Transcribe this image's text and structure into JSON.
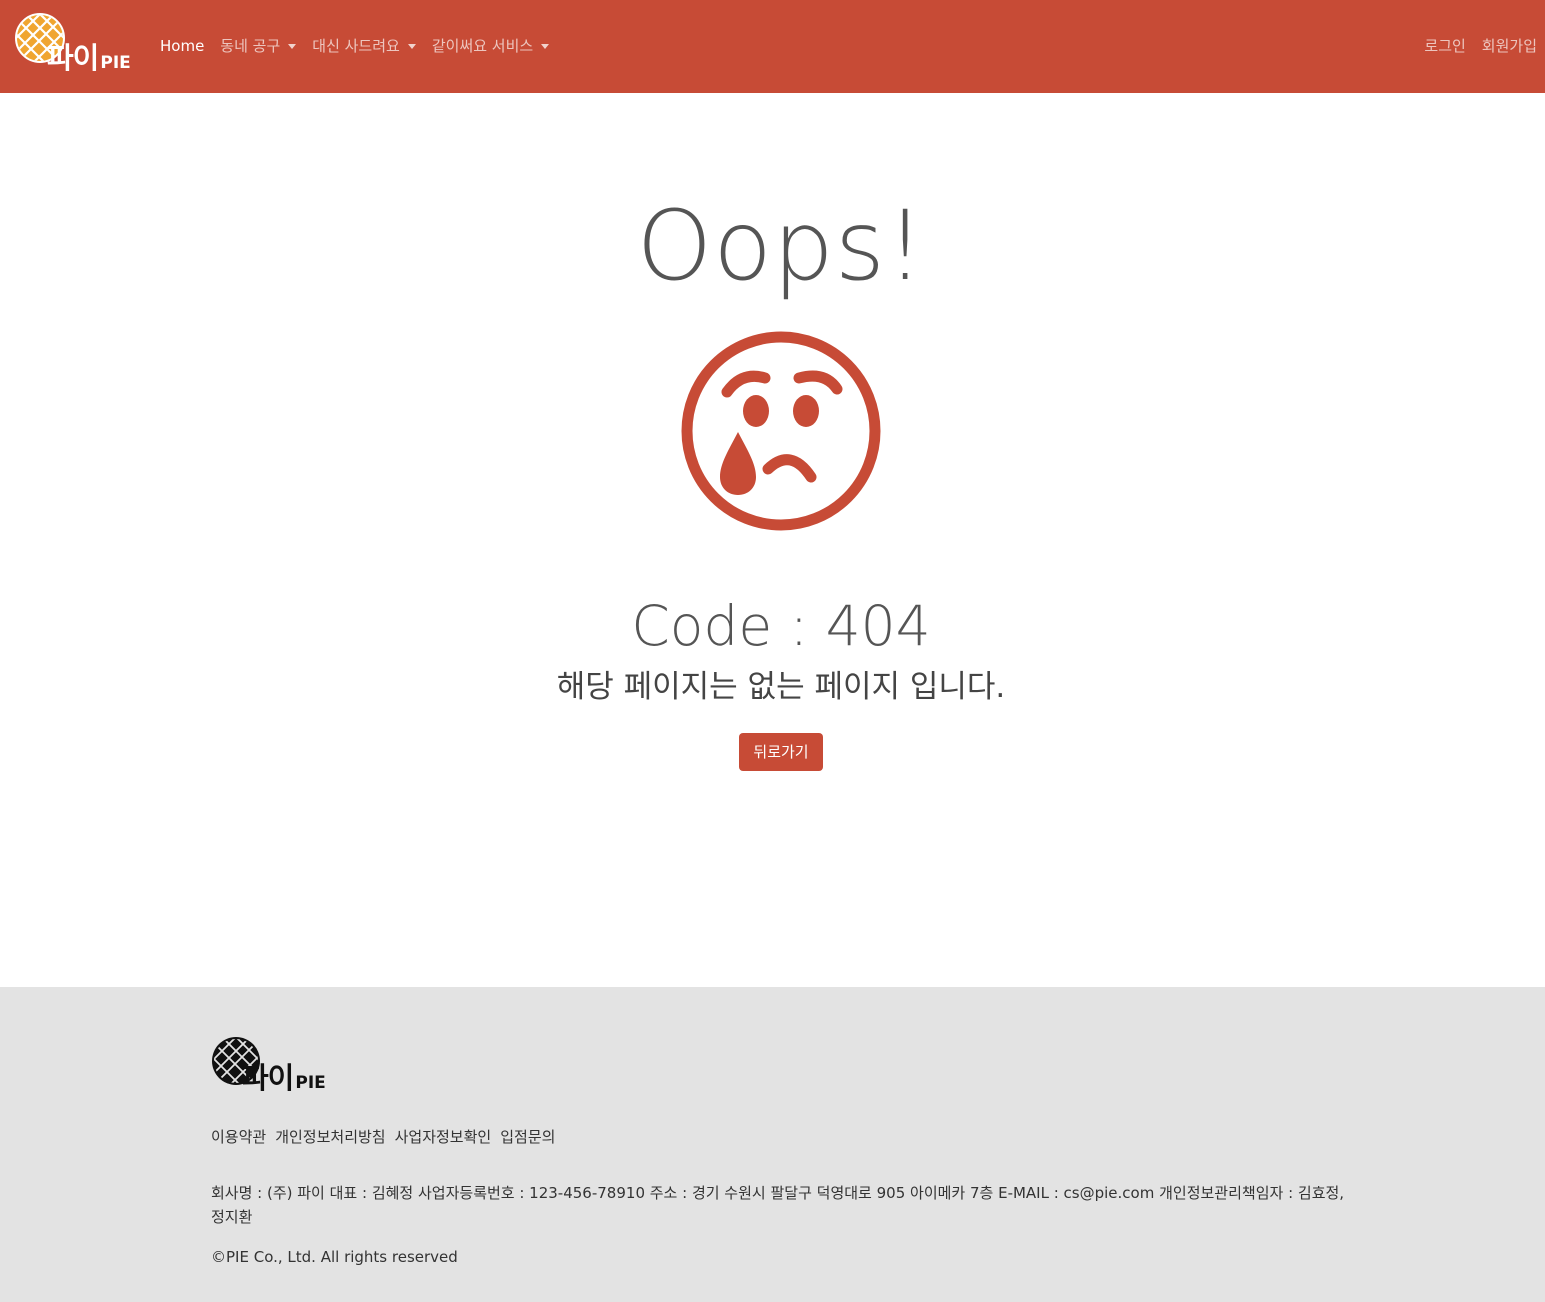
{
  "navbar": {
    "brand": {
      "main": "파이",
      "sub": "PIE"
    },
    "links": [
      {
        "label": "Home",
        "active": true,
        "dropdown": false
      },
      {
        "label": "동네 공구",
        "active": false,
        "dropdown": true
      },
      {
        "label": "대신 사드려요",
        "active": false,
        "dropdown": true
      },
      {
        "label": "같이써요 서비스",
        "active": false,
        "dropdown": true
      }
    ],
    "auth": {
      "login": "로그인",
      "signup": "회원가입"
    }
  },
  "error": {
    "headline": "Oops!",
    "code": "Code : 404",
    "message": "해당 페이지는 없는 페이지 입니다.",
    "back_button": "뒤로가기",
    "icon": "crying-face-icon"
  },
  "footer": {
    "brand": {
      "main": "파이",
      "sub": "PIE"
    },
    "links": [
      "이용약관",
      "개인정보처리방침",
      "사업자정보확인",
      "입점문의"
    ],
    "company_info": "회사명 : (주) 파이 대표 : 김혜정 사업자등록번호 : 123-456-78910 주소 : 경기 수원시 팔달구 덕영대로 905 아이메카 7층 E-MAIL : cs@pie.com 개인정보관리책임자 : 김효정, 정지환",
    "copyright": "©PIE Co., Ltd. All rights reserved"
  },
  "colors": {
    "accent": "#c74b36",
    "pie_fill": "#f0a530",
    "footer_bg": "#e3e3e3"
  }
}
